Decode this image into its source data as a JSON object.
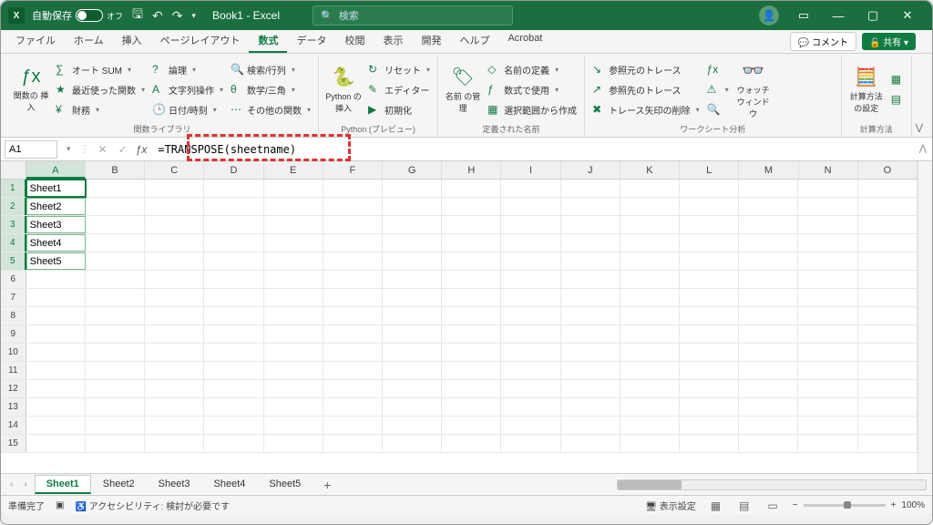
{
  "titlebar": {
    "autosave_label": "自動保存",
    "autosave_state": "オフ",
    "title": "Book1 - Excel",
    "search_placeholder": "検索"
  },
  "tabs": {
    "items": [
      "ファイル",
      "ホーム",
      "挿入",
      "ページレイアウト",
      "数式",
      "データ",
      "校閲",
      "表示",
      "開発",
      "ヘルプ",
      "Acrobat"
    ],
    "active_index": 4,
    "comment_label": "コメント",
    "share_label": "共有"
  },
  "ribbon": {
    "fx": {
      "big": "関数の\n挿入",
      "autosum": "オート SUM",
      "recent": "最近使った関数",
      "finance": "財務",
      "logic": "論理",
      "text": "文字列操作",
      "datetime": "日付/時刻",
      "lookup": "検索/行列",
      "math": "数学/三角",
      "more": "その他の関数",
      "label": "関数ライブラリ"
    },
    "python": {
      "insert": "Python\nの挿入",
      "reset": "リセット",
      "editor": "エディター",
      "init": "初期化",
      "label": "Python (プレビュー)"
    },
    "names": {
      "big": "名前\nの管理",
      "define": "名前の定義",
      "use": "数式で使用",
      "create": "選択範囲から作成",
      "label": "定義された名前"
    },
    "analysis": {
      "precedents": "参照元のトレース",
      "dependents": "参照先のトレース",
      "remove": "トレース矢印の削除",
      "watch": "ウォッチ\nウィンドウ",
      "calc": "計算方法\nの設定",
      "label": "ワークシート分析",
      "calc_label": "計算方法"
    }
  },
  "formula": {
    "cell_ref": "A1",
    "value": "=TRANSPOSE(sheetname)"
  },
  "grid": {
    "columns": [
      "A",
      "B",
      "C",
      "D",
      "E",
      "F",
      "G",
      "H",
      "I",
      "J",
      "K",
      "L",
      "M",
      "N",
      "O"
    ],
    "rows": 15,
    "data": {
      "A1": "Sheet1",
      "A2": "Sheet2",
      "A3": "Sheet3",
      "A4": "Sheet4",
      "A5": "Sheet5"
    },
    "selected": "A1",
    "spill": [
      "A1",
      "A2",
      "A3",
      "A4",
      "A5"
    ]
  },
  "sheets": {
    "items": [
      "Sheet1",
      "Sheet2",
      "Sheet3",
      "Sheet4",
      "Sheet5"
    ],
    "active_index": 0
  },
  "status": {
    "ready": "準備完了",
    "accessibility": "アクセシビリティ: 検討が必要です",
    "display_settings": "表示設定",
    "zoom": "100%"
  }
}
